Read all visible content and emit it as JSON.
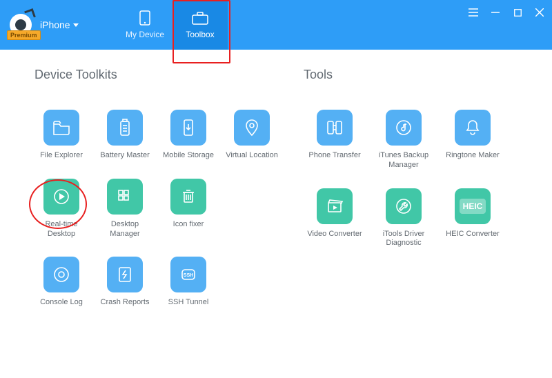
{
  "header": {
    "premium_label": "Premium",
    "device_label": "iPhone",
    "tabs": {
      "my_device": "My Device",
      "toolbox": "Toolbox"
    }
  },
  "sections": {
    "device_toolkits_title": "Device Toolkits",
    "tools_title": "Tools"
  },
  "device_toolkits": {
    "file_explorer": "File Explorer",
    "battery_master": "Battery Master",
    "mobile_storage": "Mobile Storage",
    "virtual_location": "Virtual Location",
    "realtime_desktop": "Real-time Desktop",
    "desktop_manager": "Desktop Manager",
    "icon_fixer": "Icon fixer",
    "console_log": "Console Log",
    "crash_reports": "Crash Reports",
    "ssh_tunnel": "SSH Tunnel"
  },
  "tools": {
    "phone_transfer": "Phone Transfer",
    "itunes_backup_manager": "iTunes Backup Manager",
    "ringtone_maker": "Ringtone Maker",
    "video_converter": "Video Converter",
    "itools_driver_diagnostic": "iTools Driver Diagnostic",
    "heic_converter": "HEIC Converter",
    "heic_badge": "HEIC"
  },
  "colors": {
    "header_bg": "#2e9df7",
    "header_active": "#1989e5",
    "tile_blue": "#54b0f4",
    "tile_green": "#41c7a7",
    "highlight": "#e82020"
  }
}
